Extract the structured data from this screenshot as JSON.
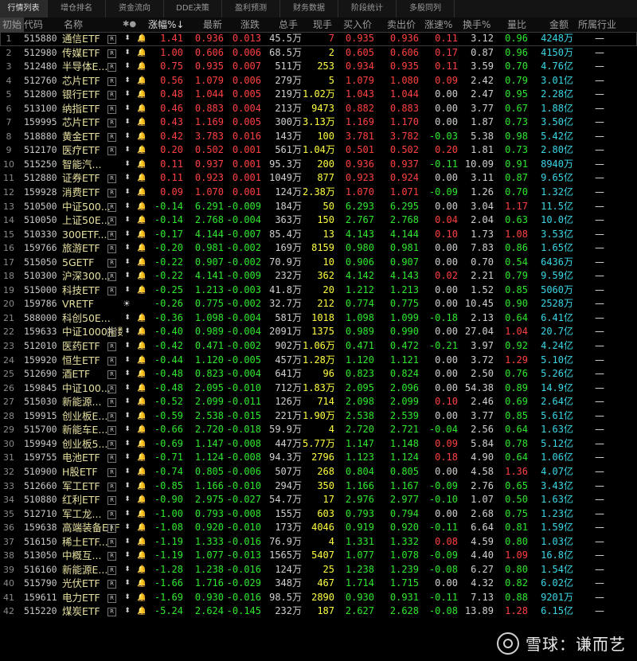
{
  "tabs": [
    "行情列表",
    "增仓排名",
    "资金流向",
    "DDE决策",
    "盈利预测",
    "财务数据",
    "阶段统计",
    "多股同列"
  ],
  "header": {
    "init": "初始",
    "code": "代码",
    "name": "名称",
    "flags": "✱●",
    "pct": "涨幅%↓",
    "last": "最新",
    "chg": "涨跌",
    "vol": "总手",
    "cur": "现手",
    "buy": "买入价",
    "sell": "卖出价",
    "speed": "涨速%",
    "turnover": "换手%",
    "ratio": "量比",
    "amount": "金额",
    "industry": "所属行业"
  },
  "rows": [
    {
      "i": "1",
      "code": "515880",
      "name": "通信ETF",
      "pct": "1.41",
      "last": "0.936",
      "chg": "0.013",
      "vol": "45.5万",
      "cur": "7",
      "buy": "0.935",
      "sell": "0.936",
      "spd": "0.11",
      "turn": "3.12",
      "ratio": "0.96",
      "amt": "4248万",
      "ind": "—"
    },
    {
      "i": "2",
      "code": "512980",
      "name": "传媒ETF",
      "pct": "1.00",
      "last": "0.606",
      "chg": "0.006",
      "vol": "68.5万",
      "cur": "2",
      "buy": "0.605",
      "sell": "0.606",
      "spd": "0.17",
      "turn": "0.87",
      "ratio": "0.96",
      "amt": "4150万",
      "ind": "—"
    },
    {
      "i": "3",
      "code": "512480",
      "name": "半导体E...",
      "pct": "0.75",
      "last": "0.935",
      "chg": "0.007",
      "vol": "511万",
      "cur": "253",
      "buy": "0.934",
      "sell": "0.935",
      "spd": "0.11",
      "turn": "3.59",
      "ratio": "0.70",
      "amt": "4.76亿",
      "ind": "—"
    },
    {
      "i": "4",
      "code": "512760",
      "name": "芯片ETF",
      "pct": "0.56",
      "last": "1.079",
      "chg": "0.006",
      "vol": "279万",
      "cur": "5",
      "buy": "1.079",
      "sell": "1.080",
      "spd": "0.09",
      "turn": "2.42",
      "ratio": "0.79",
      "amt": "3.01亿",
      "ind": "—"
    },
    {
      "i": "5",
      "code": "512800",
      "name": "银行ETF",
      "pct": "0.48",
      "last": "1.044",
      "chg": "0.005",
      "vol": "219万",
      "cur": "1.02万",
      "buy": "1.043",
      "sell": "1.044",
      "spd": "0.00",
      "turn": "2.47",
      "ratio": "0.95",
      "amt": "2.28亿",
      "ind": "—"
    },
    {
      "i": "6",
      "code": "513100",
      "name": "纳指ETF",
      "pct": "0.46",
      "last": "0.883",
      "chg": "0.004",
      "vol": "213万",
      "cur": "9473",
      "buy": "0.882",
      "sell": "0.883",
      "spd": "0.00",
      "turn": "3.77",
      "ratio": "0.67",
      "amt": "1.88亿",
      "ind": "—"
    },
    {
      "i": "7",
      "code": "159995",
      "name": "芯片ETF",
      "pct": "0.43",
      "last": "1.169",
      "chg": "0.005",
      "vol": "300万",
      "cur": "3.13万",
      "buy": "1.169",
      "sell": "1.170",
      "spd": "0.00",
      "turn": "1.87",
      "ratio": "0.73",
      "amt": "3.50亿",
      "ind": "—"
    },
    {
      "i": "8",
      "code": "518880",
      "name": "黄金ETF",
      "pct": "0.42",
      "last": "3.783",
      "chg": "0.016",
      "vol": "143万",
      "cur": "100",
      "buy": "3.781",
      "sell": "3.782",
      "spd": "-0.03",
      "turn": "5.38",
      "ratio": "0.98",
      "amt": "5.42亿",
      "ind": "—"
    },
    {
      "i": "9",
      "code": "512170",
      "name": "医疗ETF",
      "pct": "0.20",
      "last": "0.502",
      "chg": "0.001",
      "vol": "561万",
      "cur": "1.04万",
      "buy": "0.501",
      "sell": "0.502",
      "spd": "0.20",
      "turn": "1.81",
      "ratio": "0.73",
      "amt": "2.80亿",
      "ind": "—"
    },
    {
      "i": "10",
      "code": "515250",
      "name": "智能汽...",
      "pct": "0.11",
      "last": "0.937",
      "chg": "0.001",
      "vol": "95.3万",
      "cur": "200",
      "buy": "0.936",
      "sell": "0.937",
      "spd": "-0.11",
      "turn": "10.09",
      "ratio": "0.91",
      "amt": "8940万",
      "ind": "—"
    },
    {
      "i": "11",
      "code": "512880",
      "name": "证券ETF",
      "pct": "0.11",
      "last": "0.923",
      "chg": "0.001",
      "vol": "1049万",
      "cur": "877",
      "buy": "0.923",
      "sell": "0.924",
      "spd": "0.00",
      "turn": "3.11",
      "ratio": "0.87",
      "amt": "9.65亿",
      "ind": "—"
    },
    {
      "i": "12",
      "code": "159928",
      "name": "消费ETF",
      "pct": "0.09",
      "last": "1.070",
      "chg": "0.001",
      "vol": "124万",
      "cur": "2.38万",
      "buy": "1.070",
      "sell": "1.071",
      "spd": "-0.09",
      "turn": "1.26",
      "ratio": "0.70",
      "amt": "1.32亿",
      "ind": "—"
    },
    {
      "i": "13",
      "code": "510500",
      "name": "中证500...",
      "pct": "-0.14",
      "last": "6.291",
      "chg": "-0.009",
      "vol": "184万",
      "cur": "50",
      "buy": "6.293",
      "sell": "6.295",
      "spd": "0.00",
      "turn": "3.04",
      "ratio": "1.17",
      "amt": "11.5亿",
      "ind": "—"
    },
    {
      "i": "14",
      "code": "510050",
      "name": "上证50E...",
      "pct": "-0.14",
      "last": "2.768",
      "chg": "-0.004",
      "vol": "363万",
      "cur": "150",
      "buy": "2.767",
      "sell": "2.768",
      "spd": "0.04",
      "turn": "2.04",
      "ratio": "0.63",
      "amt": "10.0亿",
      "ind": "—"
    },
    {
      "i": "15",
      "code": "510330",
      "name": "300ETF...",
      "pct": "-0.17",
      "last": "4.144",
      "chg": "-0.007",
      "vol": "85.4万",
      "cur": "13",
      "buy": "4.143",
      "sell": "4.144",
      "spd": "0.10",
      "turn": "1.73",
      "ratio": "1.08",
      "amt": "3.53亿",
      "ind": "—"
    },
    {
      "i": "16",
      "code": "159766",
      "name": "旅游ETF",
      "pct": "-0.20",
      "last": "0.981",
      "chg": "-0.002",
      "vol": "169万",
      "cur": "8159",
      "buy": "0.980",
      "sell": "0.981",
      "spd": "0.00",
      "turn": "7.83",
      "ratio": "0.86",
      "amt": "1.65亿",
      "ind": "—"
    },
    {
      "i": "17",
      "code": "515050",
      "name": "5GETF",
      "pct": "-0.22",
      "last": "0.907",
      "chg": "-0.002",
      "vol": "70.9万",
      "cur": "10",
      "buy": "0.906",
      "sell": "0.907",
      "spd": "0.00",
      "turn": "0.70",
      "ratio": "0.54",
      "amt": "6436万",
      "ind": "—"
    },
    {
      "i": "18",
      "code": "510300",
      "name": "沪深300...",
      "pct": "-0.22",
      "last": "4.141",
      "chg": "-0.009",
      "vol": "232万",
      "cur": "362",
      "buy": "4.142",
      "sell": "4.143",
      "spd": "0.02",
      "turn": "2.21",
      "ratio": "0.79",
      "amt": "9.59亿",
      "ind": "—"
    },
    {
      "i": "19",
      "code": "515000",
      "name": "科技ETF",
      "pct": "-0.25",
      "last": "1.213",
      "chg": "-0.003",
      "vol": "41.8万",
      "cur": "20",
      "buy": "1.212",
      "sell": "1.213",
      "spd": "0.00",
      "turn": "1.52",
      "ratio": "0.85",
      "amt": "5060万",
      "ind": "—"
    },
    {
      "i": "20",
      "code": "159786",
      "name": "VRETF",
      "pct": "-0.26",
      "last": "0.775",
      "chg": "-0.002",
      "vol": "32.7万",
      "cur": "212",
      "buy": "0.774",
      "sell": "0.775",
      "spd": "0.00",
      "turn": "10.45",
      "ratio": "0.90",
      "amt": "2528万",
      "ind": "—"
    },
    {
      "i": "21",
      "code": "588000",
      "name": "科创50E...",
      "pct": "-0.36",
      "last": "1.098",
      "chg": "-0.004",
      "vol": "581万",
      "cur": "1018",
      "buy": "1.098",
      "sell": "1.099",
      "spd": "-0.18",
      "turn": "2.13",
      "ratio": "0.64",
      "amt": "6.41亿",
      "ind": "—"
    },
    {
      "i": "22",
      "code": "159633",
      "name": "中证1000指数...",
      "pct": "-0.40",
      "last": "0.989",
      "chg": "-0.004",
      "vol": "2091万",
      "cur": "1375",
      "buy": "0.989",
      "sell": "0.990",
      "spd": "0.00",
      "turn": "27.04",
      "ratio": "1.04",
      "amt": "20.7亿",
      "ind": "—"
    },
    {
      "i": "23",
      "code": "512010",
      "name": "医药ETF",
      "pct": "-0.42",
      "last": "0.471",
      "chg": "-0.002",
      "vol": "902万",
      "cur": "1.06万",
      "buy": "0.471",
      "sell": "0.472",
      "spd": "-0.21",
      "turn": "3.97",
      "ratio": "0.92",
      "amt": "4.24亿",
      "ind": "—"
    },
    {
      "i": "24",
      "code": "159920",
      "name": "恒生ETF",
      "pct": "-0.44",
      "last": "1.120",
      "chg": "-0.005",
      "vol": "457万",
      "cur": "1.28万",
      "buy": "1.120",
      "sell": "1.121",
      "spd": "0.00",
      "turn": "3.72",
      "ratio": "1.29",
      "amt": "5.10亿",
      "ind": "—"
    },
    {
      "i": "25",
      "code": "512690",
      "name": "酒ETF",
      "pct": "-0.48",
      "last": "0.823",
      "chg": "-0.004",
      "vol": "641万",
      "cur": "96",
      "buy": "0.823",
      "sell": "0.824",
      "spd": "0.00",
      "turn": "2.50",
      "ratio": "0.76",
      "amt": "5.26亿",
      "ind": "—"
    },
    {
      "i": "26",
      "code": "159845",
      "name": "中证100...",
      "pct": "-0.48",
      "last": "2.095",
      "chg": "-0.010",
      "vol": "712万",
      "cur": "1.83万",
      "buy": "2.095",
      "sell": "2.096",
      "spd": "0.00",
      "turn": "54.38",
      "ratio": "0.89",
      "amt": "14.9亿",
      "ind": "—"
    },
    {
      "i": "27",
      "code": "515030",
      "name": "新能源...",
      "pct": "-0.52",
      "last": "2.099",
      "chg": "-0.011",
      "vol": "126万",
      "cur": "714",
      "buy": "2.098",
      "sell": "2.099",
      "spd": "0.10",
      "turn": "2.46",
      "ratio": "0.69",
      "amt": "2.64亿",
      "ind": "—"
    },
    {
      "i": "28",
      "code": "159915",
      "name": "创业板E...",
      "pct": "-0.59",
      "last": "2.538",
      "chg": "-0.015",
      "vol": "221万",
      "cur": "1.90万",
      "buy": "2.538",
      "sell": "2.539",
      "spd": "0.00",
      "turn": "3.77",
      "ratio": "0.85",
      "amt": "5.61亿",
      "ind": "—"
    },
    {
      "i": "29",
      "code": "515700",
      "name": "新能车E...",
      "pct": "-0.66",
      "last": "2.720",
      "chg": "-0.018",
      "vol": "59.9万",
      "cur": "4",
      "buy": "2.720",
      "sell": "2.721",
      "spd": "-0.04",
      "turn": "2.56",
      "ratio": "0.64",
      "amt": "1.63亿",
      "ind": "—"
    },
    {
      "i": "30",
      "code": "159949",
      "name": "创业板5...",
      "pct": "-0.69",
      "last": "1.147",
      "chg": "-0.008",
      "vol": "447万",
      "cur": "5.77万",
      "buy": "1.147",
      "sell": "1.148",
      "spd": "0.09",
      "turn": "5.84",
      "ratio": "0.78",
      "amt": "5.12亿",
      "ind": "—"
    },
    {
      "i": "31",
      "code": "159755",
      "name": "电池ETF",
      "pct": "-0.71",
      "last": "1.124",
      "chg": "-0.008",
      "vol": "94.3万",
      "cur": "2796",
      "buy": "1.123",
      "sell": "1.124",
      "spd": "0.18",
      "turn": "4.90",
      "ratio": "0.64",
      "amt": "1.06亿",
      "ind": "—"
    },
    {
      "i": "32",
      "code": "510900",
      "name": "H股ETF",
      "pct": "-0.74",
      "last": "0.805",
      "chg": "-0.006",
      "vol": "507万",
      "cur": "268",
      "buy": "0.804",
      "sell": "0.805",
      "spd": "0.00",
      "turn": "4.58",
      "ratio": "1.36",
      "amt": "4.07亿",
      "ind": "—"
    },
    {
      "i": "33",
      "code": "512660",
      "name": "军工ETF",
      "pct": "-0.85",
      "last": "1.166",
      "chg": "-0.010",
      "vol": "294万",
      "cur": "350",
      "buy": "1.166",
      "sell": "1.167",
      "spd": "-0.09",
      "turn": "2.76",
      "ratio": "0.65",
      "amt": "3.43亿",
      "ind": "—"
    },
    {
      "i": "34",
      "code": "510880",
      "name": "红利ETF",
      "pct": "-0.90",
      "last": "2.975",
      "chg": "-0.027",
      "vol": "54.7万",
      "cur": "17",
      "buy": "2.976",
      "sell": "2.977",
      "spd": "-0.10",
      "turn": "1.07",
      "ratio": "0.50",
      "amt": "1.63亿",
      "ind": "—"
    },
    {
      "i": "35",
      "code": "512710",
      "name": "军工龙...",
      "pct": "-1.00",
      "last": "0.793",
      "chg": "-0.008",
      "vol": "155万",
      "cur": "603",
      "buy": "0.793",
      "sell": "0.794",
      "spd": "0.00",
      "turn": "2.68",
      "ratio": "0.75",
      "amt": "1.23亿",
      "ind": "—"
    },
    {
      "i": "36",
      "code": "159638",
      "name": "高端装备ETF",
      "pct": "-1.08",
      "last": "0.920",
      "chg": "-0.010",
      "vol": "173万",
      "cur": "4046",
      "buy": "0.919",
      "sell": "0.920",
      "spd": "-0.11",
      "turn": "6.64",
      "ratio": "0.81",
      "amt": "1.59亿",
      "ind": "—"
    },
    {
      "i": "37",
      "code": "516150",
      "name": "稀土ETF...",
      "pct": "-1.19",
      "last": "1.333",
      "chg": "-0.016",
      "vol": "76.9万",
      "cur": "4",
      "buy": "1.331",
      "sell": "1.332",
      "spd": "0.08",
      "turn": "4.59",
      "ratio": "0.80",
      "amt": "1.03亿",
      "ind": "—"
    },
    {
      "i": "38",
      "code": "513050",
      "name": "中概互...",
      "pct": "-1.19",
      "last": "1.077",
      "chg": "-0.013",
      "vol": "1565万",
      "cur": "5407",
      "buy": "1.077",
      "sell": "1.078",
      "spd": "-0.09",
      "turn": "4.40",
      "ratio": "1.09",
      "amt": "16.8亿",
      "ind": "—"
    },
    {
      "i": "39",
      "code": "516160",
      "name": "新能源E...",
      "pct": "-1.28",
      "last": "1.238",
      "chg": "-0.016",
      "vol": "124万",
      "cur": "25",
      "buy": "1.238",
      "sell": "1.239",
      "spd": "-0.08",
      "turn": "6.27",
      "ratio": "0.80",
      "amt": "1.54亿",
      "ind": "—"
    },
    {
      "i": "40",
      "code": "515790",
      "name": "光伏ETF",
      "pct": "-1.66",
      "last": "1.716",
      "chg": "-0.029",
      "vol": "348万",
      "cur": "467",
      "buy": "1.714",
      "sell": "1.715",
      "spd": "0.00",
      "turn": "4.32",
      "ratio": "0.82",
      "amt": "6.02亿",
      "ind": "—"
    },
    {
      "i": "41",
      "code": "159611",
      "name": "电力ETF",
      "pct": "-1.69",
      "last": "0.930",
      "chg": "-0.016",
      "vol": "98.5万",
      "cur": "2890",
      "buy": "0.930",
      "sell": "0.931",
      "spd": "-0.11",
      "turn": "7.13",
      "ratio": "0.88",
      "amt": "9201万",
      "ind": "—"
    },
    {
      "i": "42",
      "code": "515220",
      "name": "煤炭ETF",
      "pct": "-5.24",
      "last": "2.624",
      "chg": "-0.145",
      "vol": "232万",
      "cur": "187",
      "buy": "2.627",
      "sell": "2.628",
      "spd": "-0.08",
      "turn": "13.89",
      "ratio": "1.28",
      "amt": "6.15亿",
      "ind": "—"
    }
  ],
  "watermark": {
    "text": "雪球：谦而艺"
  }
}
